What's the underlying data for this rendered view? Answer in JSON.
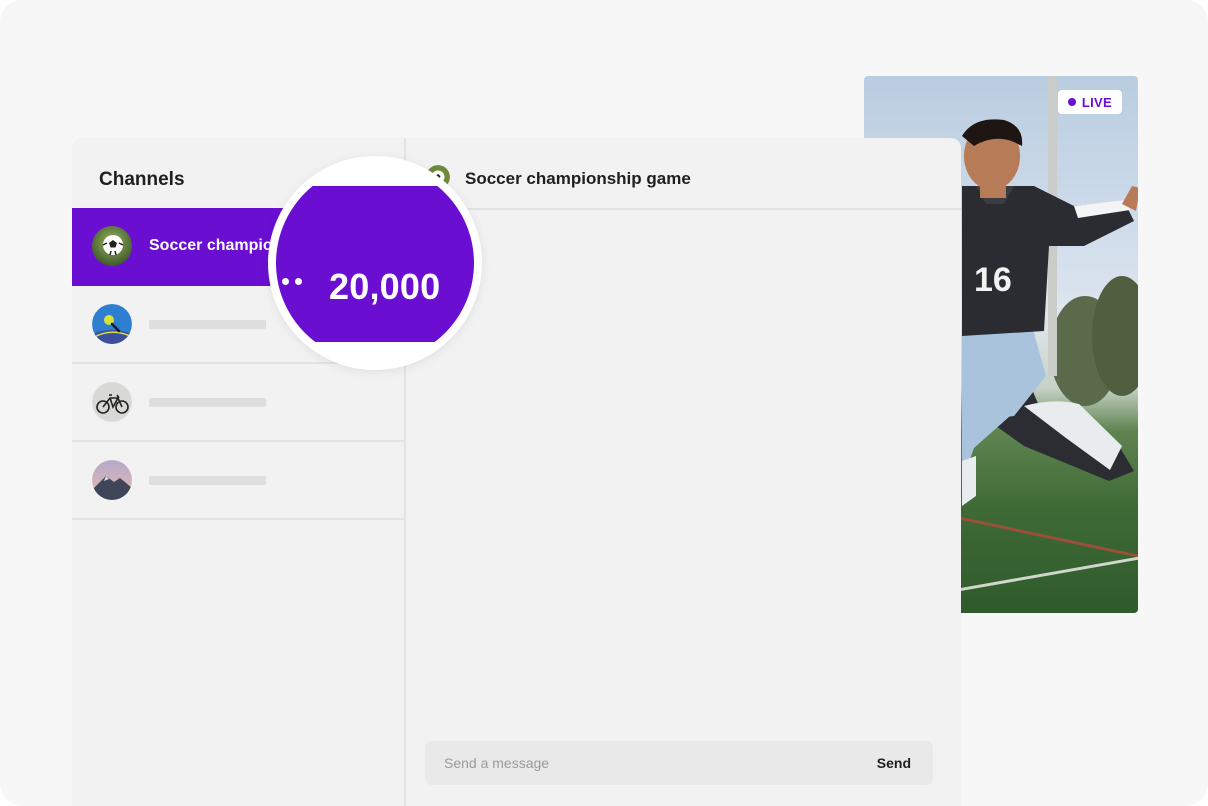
{
  "video": {
    "live_label": "LIVE",
    "jersey_number": "16"
  },
  "sidebar": {
    "title": "Channels",
    "channels": [
      {
        "name": "Soccer champio",
        "icon": "soccer-ball-avatar",
        "active": true
      },
      {
        "name": "",
        "icon": "tennis-ball-avatar",
        "active": false
      },
      {
        "name": "",
        "icon": "bicycle-avatar",
        "active": false
      },
      {
        "name": "",
        "icon": "mountain-avatar",
        "active": false
      }
    ]
  },
  "chat": {
    "title": "Soccer championship game",
    "input_placeholder": "Send a message",
    "send_label": "Send"
  },
  "magnifier": {
    "viewer_count": "20,000"
  },
  "colors": {
    "accent": "#6a0fd2",
    "background": "#f2f2f2",
    "divider": "#e3e3e3"
  }
}
